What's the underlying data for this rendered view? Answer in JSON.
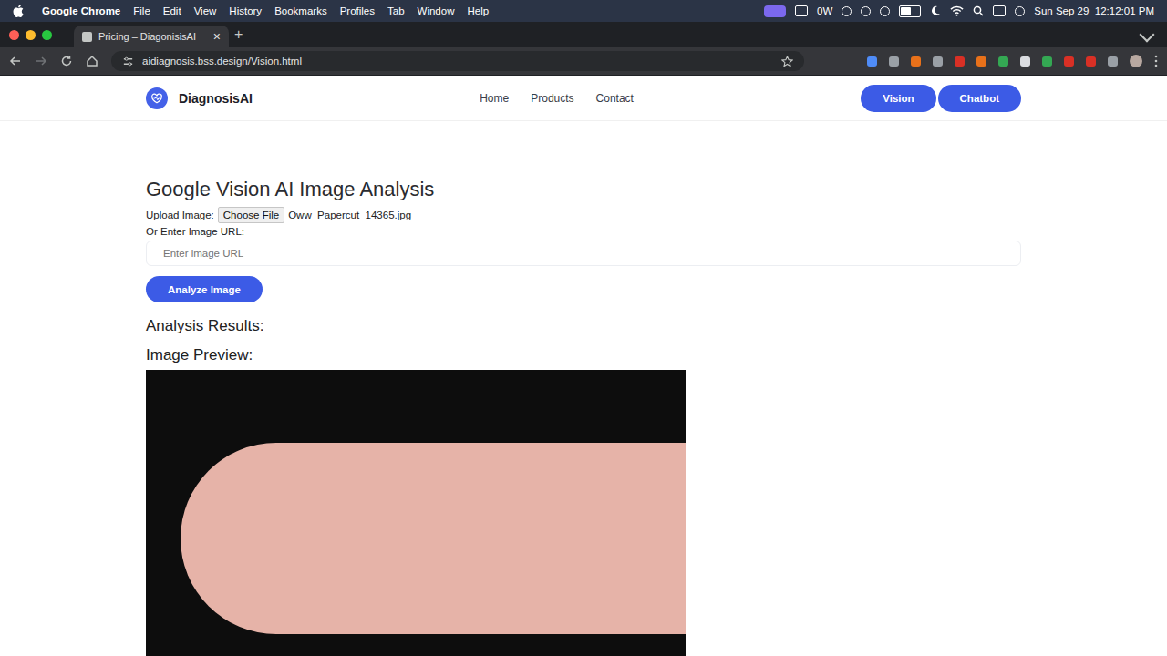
{
  "menubar": {
    "app": "Google Chrome",
    "menus": [
      "File",
      "Edit",
      "View",
      "History",
      "Bookmarks",
      "Profiles",
      "Tab",
      "Window",
      "Help"
    ],
    "power": "0W",
    "clock": "Sun Sep 29  12:12:01 PM"
  },
  "browser": {
    "tabs": [
      {
        "title": "Pricing – DiagonisisAI",
        "close": "×",
        "selected": true
      }
    ],
    "new_tab": "+",
    "url": "aidiagnosis.bss.design/Vision.html"
  },
  "site": {
    "logo": "DiagnosisAI",
    "nav": [
      {
        "label": "Home"
      },
      {
        "label": "Products"
      },
      {
        "label": "Contact"
      }
    ],
    "actions": [
      {
        "label": "Vision"
      },
      {
        "label": "Chatbot"
      }
    ]
  },
  "page": {
    "title": "Google Vision AI Image Analysis",
    "upload_label": "Upload Image:",
    "file_button": "Choose File",
    "file_name": "Oww_Papercut_14365.jpg",
    "url_label": "Or Enter Image URL:",
    "url_placeholder": "Enter image URL",
    "analyze_button": "Analyze Image",
    "results_heading": "Analysis Results:",
    "preview_heading": "Image Preview:"
  }
}
